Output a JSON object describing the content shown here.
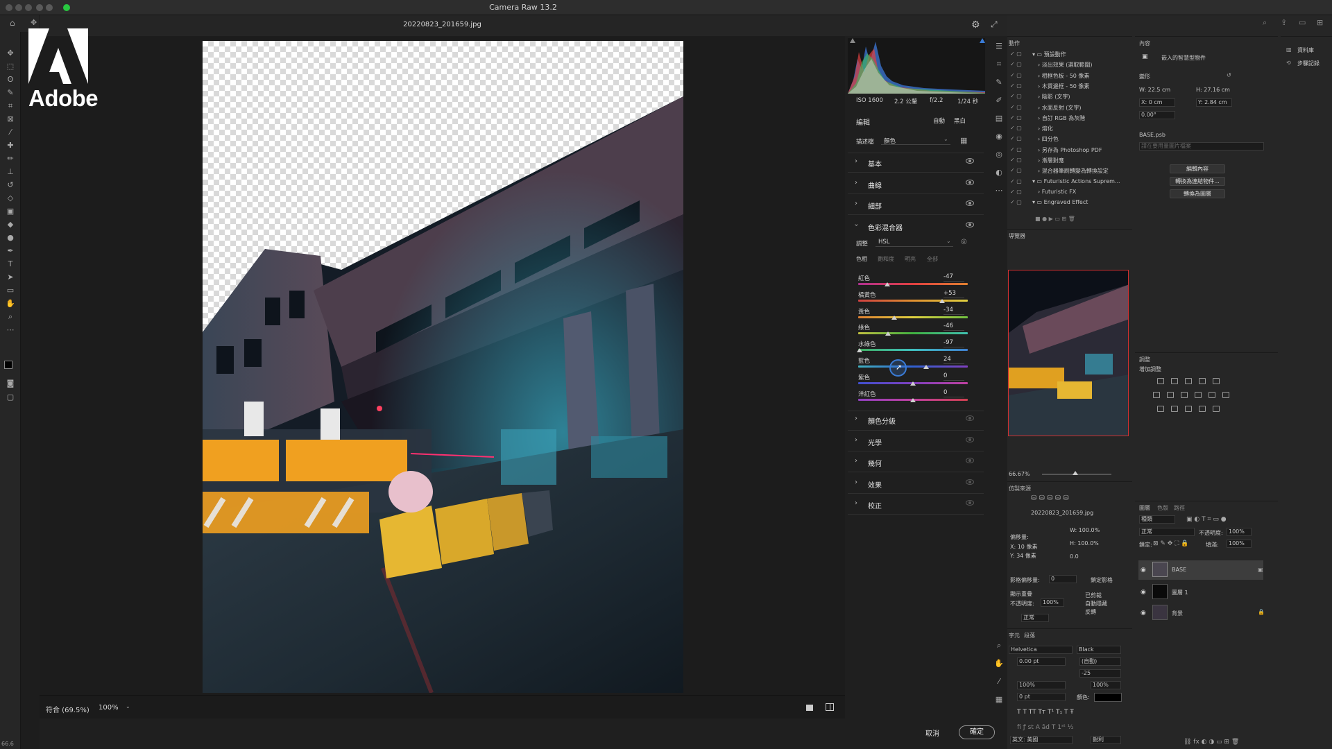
{
  "window": {
    "title": "Camera Raw 13.2",
    "filename": "20220823_201659.jpg"
  },
  "logo": {
    "wordmark": "Adobe"
  },
  "histogram": {
    "exif": [
      "ISO 1600",
      "2.2 公釐",
      "f/2.2",
      "1/24 秒"
    ]
  },
  "edit": {
    "header": "編輯",
    "auto": "自動",
    "bw": "黑白",
    "profile_label": "描述檔",
    "profile_value": "顏色",
    "sections_top": [
      {
        "label": "基本"
      },
      {
        "label": "曲線"
      },
      {
        "label": "細部"
      }
    ],
    "color_mixer": {
      "label": "色彩混合器",
      "adjust_label": "調整",
      "adjust_value": "HSL",
      "tabs": [
        "色相",
        "飽和度",
        "明亮",
        "全部"
      ],
      "sliders": [
        {
          "label": "紅色",
          "value": "-47",
          "pos": 0.265
        },
        {
          "label": "橘黃色",
          "value": "+53",
          "pos": 0.765
        },
        {
          "label": "黃色",
          "value": "-34",
          "pos": 0.33
        },
        {
          "label": "綠色",
          "value": "-46",
          "pos": 0.27
        },
        {
          "label": "水綠色",
          "value": "-97",
          "pos": 0.015
        },
        {
          "label": "藍色",
          "value": "24",
          "pos": 0.62
        },
        {
          "label": "紫色",
          "value": "0",
          "pos": 0.5
        },
        {
          "label": "洋紅色",
          "value": "0",
          "pos": 0.5
        }
      ]
    },
    "sections_bottom": [
      {
        "label": "顏色分級"
      },
      {
        "label": "光學"
      },
      {
        "label": "幾何"
      },
      {
        "label": "效果"
      },
      {
        "label": "校正"
      }
    ]
  },
  "bottom": {
    "fit": "符合 (69.5%)",
    "zoom": "100%"
  },
  "footer": {
    "cancel": "取消",
    "ok": "確定",
    "status": "66.6"
  },
  "ps": {
    "actions": {
      "tab": "動作",
      "items": [
        "預設動作",
        "淡出效果 (選取範圍)",
        "相框色板 - 50 像素",
        "木質邊框 - 50 像素",
        "陰影 (文字)",
        "水面反射 (文字)",
        "自訂 RGB 為灰階",
        "熔化",
        "四分色",
        "另存為 Photoshop PDF",
        "漸層對應",
        "混合器筆刷轉變為轉換設定",
        "Futuristic Actions Suprem...",
        "Futuristic FX",
        "Engraved Effect"
      ]
    },
    "properties": {
      "tab": "內容",
      "title": "嵌入的智慧型物件",
      "transform": "變形",
      "w": "W: 22.5 cm",
      "h": "H: 27.16 cm",
      "x": "X: 0 cm",
      "y": "Y: 2.84 cm",
      "angle": "0.00°",
      "smart_name": "BASE.psb",
      "smart_placeholder": "請在要用量圖片檔案",
      "btn_edit": "編輯內容",
      "btn_convert_linked": "轉換為連結物件...",
      "btn_convert_layers": "轉換為圖層"
    },
    "navigator": {
      "tab": "導覽器",
      "zoom": "66.67%"
    },
    "adjustments": {
      "tab": "調整",
      "sub": "增加調整"
    },
    "library": {
      "tab": "資料庫",
      "history": "步驟記錄"
    },
    "clone": {
      "tab": "仿製來源",
      "file": "20220823_201659.jpg",
      "offset": "偏移量:",
      "x": "X: 10 像素",
      "y": "Y: 34 像素",
      "w": "W: 100.0%",
      "h": "H: 100.0%",
      "angle": "0.0",
      "frame_offset": "影格偏移量:",
      "frame_val": "0",
      "lock_frame": "鎖定影格",
      "show_overlay": "顯示重疊",
      "opacity_label": "不透明度:",
      "opacity_val": "100%",
      "mode": "正常",
      "clipped": "已剪裁",
      "auto_hide": "自動隱藏",
      "invert": "反轉"
    },
    "character": {
      "tabs": [
        "字元",
        "段落"
      ],
      "font": "Helvetica",
      "style": "Black",
      "size": "0.00 pt",
      "leading": "(自動)",
      "tracking": "-25",
      "vscale": "100%",
      "hscale": "100%",
      "baseline": "0 pt",
      "color_label": "顏色:",
      "lang": "英文: 美國",
      "aa": "銳利"
    },
    "layers": {
      "tabs": [
        "圖層",
        "色版",
        "路徑"
      ],
      "kind": "種類",
      "blend": "正常",
      "opacity_label": "不透明度:",
      "opacity": "100%",
      "lock_label": "鎖定:",
      "fill_label": "填滿:",
      "fill": "100%",
      "items": [
        {
          "name": "BASE"
        },
        {
          "name": "圖層 1"
        },
        {
          "name": "背景"
        }
      ]
    }
  }
}
